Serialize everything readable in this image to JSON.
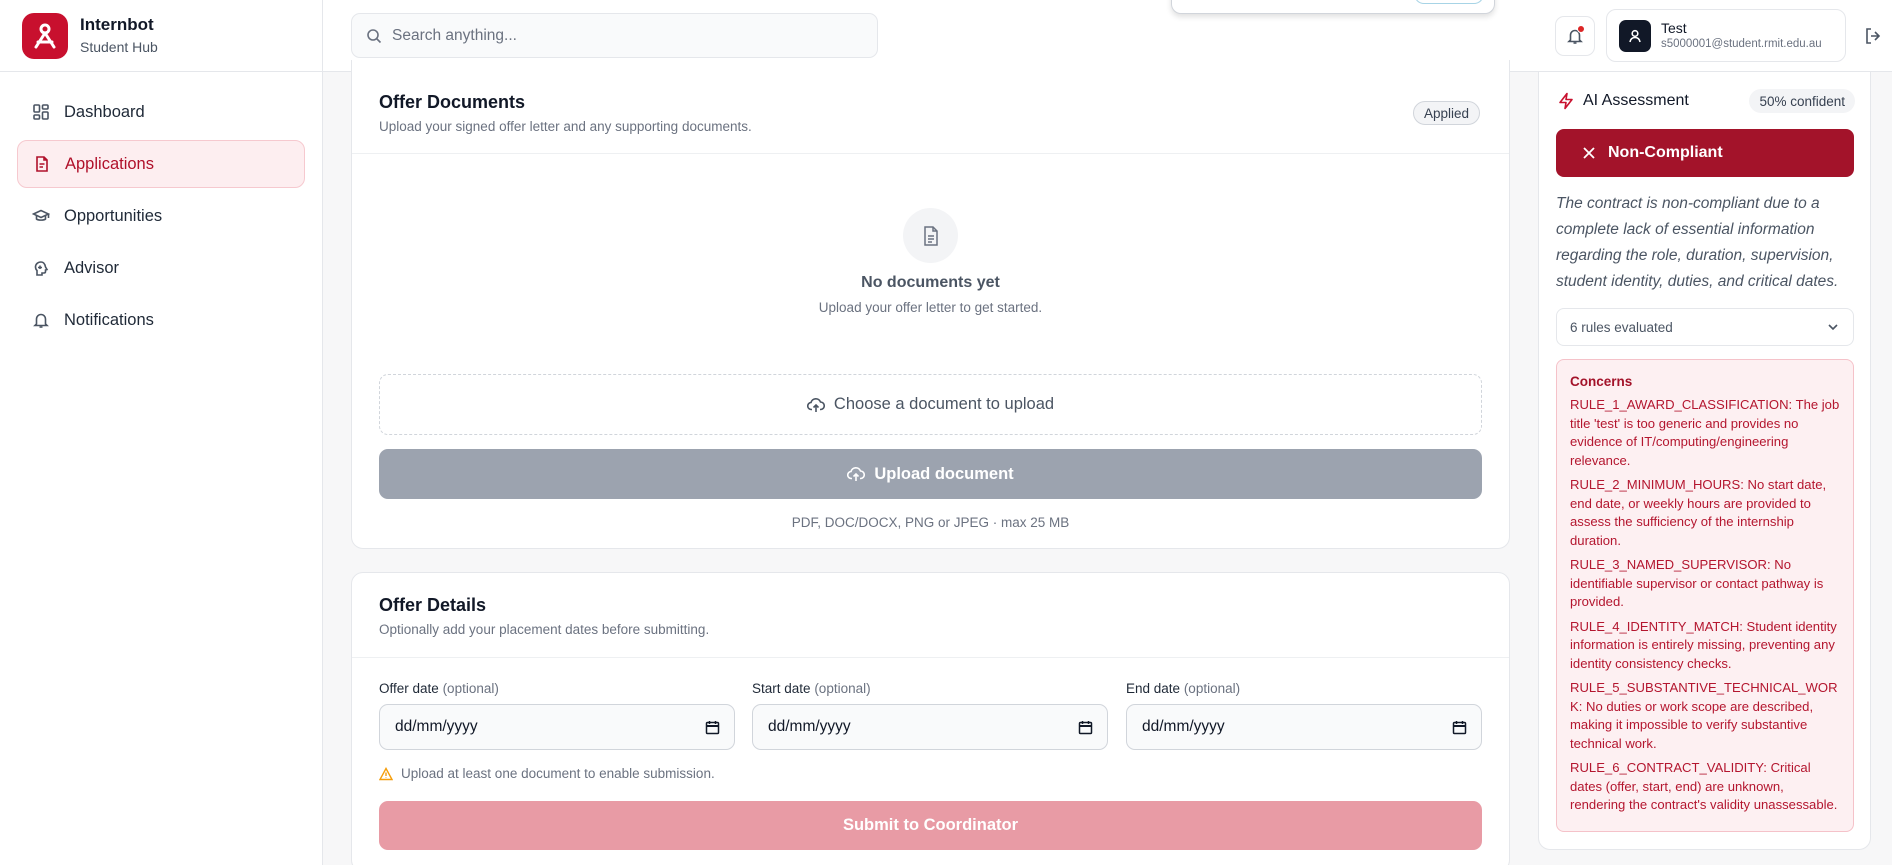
{
  "brand": {
    "name": "Internbot",
    "subtitle": "Student Hub"
  },
  "nav": [
    {
      "label": "Dashboard",
      "icon": "dashboard-icon",
      "active": false
    },
    {
      "label": "Applications",
      "icon": "file-icon",
      "active": true
    },
    {
      "label": "Opportunities",
      "icon": "graduation-cap-icon",
      "active": false
    },
    {
      "label": "Advisor",
      "icon": "brain-icon",
      "active": false
    },
    {
      "label": "Notifications",
      "icon": "bell-icon",
      "active": false
    }
  ],
  "search": {
    "placeholder": "Search anything..."
  },
  "user": {
    "name": "Test",
    "email": "s5000001@student.rmit.edu.au"
  },
  "offer_documents": {
    "title": "Offer Documents",
    "subtitle": "Upload your signed offer letter and any supporting documents.",
    "status_badge": "Applied",
    "empty_title": "No documents yet",
    "empty_subtitle": "Upload your offer letter to get started.",
    "choose_label": "Choose a document to upload",
    "upload_label": "Upload document",
    "formats_hint": "PDF, DOC/DOCX, PNG or JPEG · max 25 MB"
  },
  "offer_details": {
    "title": "Offer Details",
    "subtitle": "Optionally add your placement dates before submitting.",
    "fields": [
      {
        "label": "Offer date",
        "optional": "(optional)",
        "value": "dd/mm/yyyy"
      },
      {
        "label": "Start date",
        "optional": "(optional)",
        "value": "dd/mm/yyyy"
      },
      {
        "label": "End date",
        "optional": "(optional)",
        "value": "dd/mm/yyyy"
      }
    ],
    "warning": "Upload at least one document to enable submission.",
    "submit_label": "Submit to Coordinator"
  },
  "ai_assessment": {
    "title": "AI Assessment",
    "confidence": "50% confident",
    "verdict": "Non-Compliant",
    "summary": "The contract is non-compliant due to a complete lack of essential information regarding the role, duration, supervision, student identity, duties, and critical dates.",
    "rules_evaluated": "6 rules evaluated",
    "concerns_title": "Concerns",
    "concerns": [
      "RULE_1_AWARD_CLASSIFICATION: The job title 'test' is too generic and provides no evidence of IT/computing/engineering relevance.",
      "RULE_2_MINIMUM_HOURS: No start date, end date, or weekly hours are provided to assess the sufficiency of the internship duration.",
      "RULE_3_NAMED_SUPERVISOR: No identifiable supervisor or contact pathway is provided.",
      "RULE_4_IDENTITY_MATCH: Student identity information is entirely missing, preventing any identity consistency checks.",
      "RULE_5_SUBSTANTIVE_TECHNICAL_WORK: No duties or work scope are described, making it impossible to verify substantive technical work.",
      "RULE_6_CONTRACT_VALIDITY: Critical dates (offer, start, end) are unknown, rendering the contract's validity unassessable."
    ]
  },
  "colors": {
    "brand": "#c8102e",
    "verdict": "#a3132a",
    "concern_text": "#b4162f",
    "disabled_button": "#9ca3af",
    "submit_disabled": "#e89ba5"
  }
}
